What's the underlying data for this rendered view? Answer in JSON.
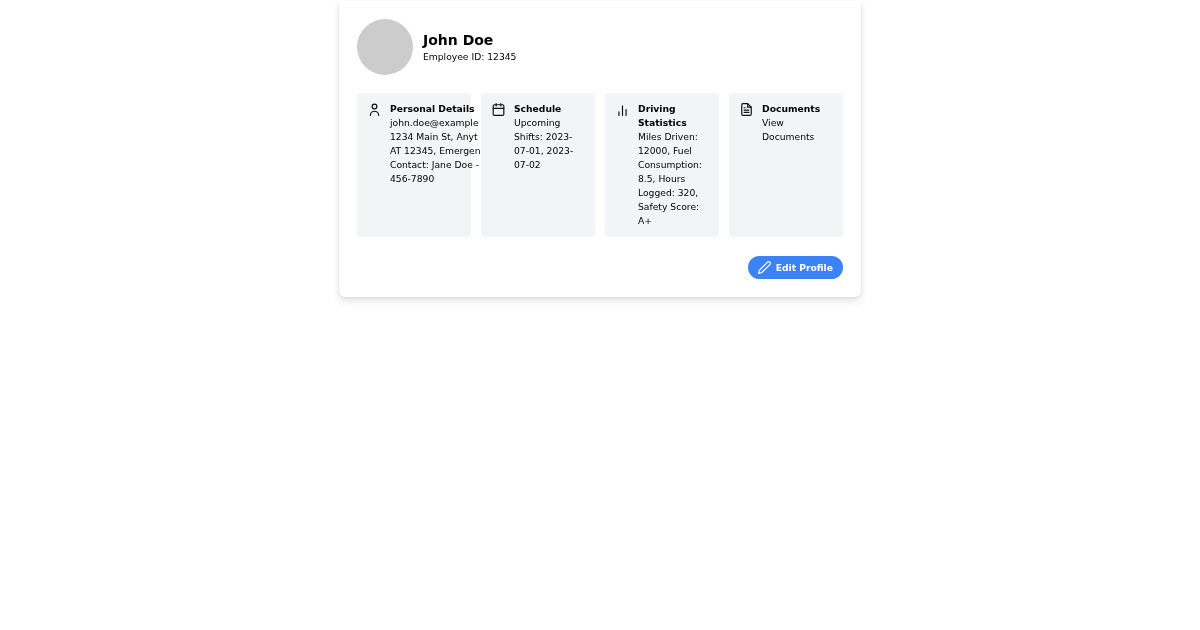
{
  "profile": {
    "name": "John Doe",
    "employee_id": "Employee ID: 12345"
  },
  "sections": [
    {
      "kind": "personal",
      "title": "Personal Details",
      "lines": [
        "john.doe@example",
        "1234 Main St, Anyt",
        "AT 12345, Emergen",
        "Contact: Jane Doe -",
        "456-7890"
      ]
    },
    {
      "kind": "schedule",
      "title": "Schedule",
      "lines": [
        "Upcoming",
        "Shifts: 2023-",
        "07-01, 2023-",
        "07-02"
      ]
    },
    {
      "kind": "statistics",
      "title": "Driving Statistics",
      "lines": [
        "Miles Driven:",
        "12000, Fuel",
        "Consumption:",
        "8.5, Hours",
        "Logged: 320,",
        "Safety Score:",
        "A+"
      ]
    },
    {
      "kind": "documents",
      "title": "Documents",
      "lines": [
        "View",
        "Documents"
      ]
    }
  ],
  "edit_button": {
    "label": "Edit Profile"
  }
}
